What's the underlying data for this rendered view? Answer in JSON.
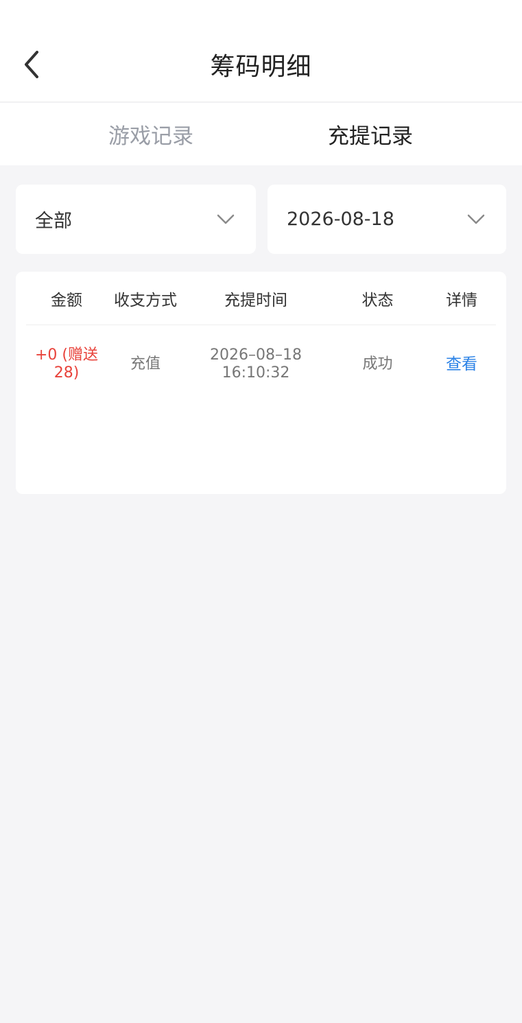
{
  "header": {
    "title": "筹码明细"
  },
  "tabs": [
    {
      "label": "游戏记录"
    },
    {
      "label": "充提记录"
    }
  ],
  "filters": {
    "type": {
      "value": "全部"
    },
    "date": {
      "value": "2026-08-18"
    }
  },
  "table": {
    "columns": [
      "金额",
      "收支方式",
      "充提时间",
      "状态",
      "详情"
    ],
    "rows": [
      {
        "amount_line1": "+0 (赠送",
        "amount_line2": "28)",
        "method": "充值",
        "date": "2026–08–18",
        "time": "16:10:32",
        "status": "成功",
        "action": "查看"
      }
    ]
  },
  "colors": {
    "amount": "#e8423a",
    "link": "#2b82e6",
    "tab_inactive": "#9a9ea7",
    "tab_active": "#222222"
  },
  "icons": {
    "back": "chevron-left-icon",
    "dropdown": "chevron-down-icon"
  }
}
